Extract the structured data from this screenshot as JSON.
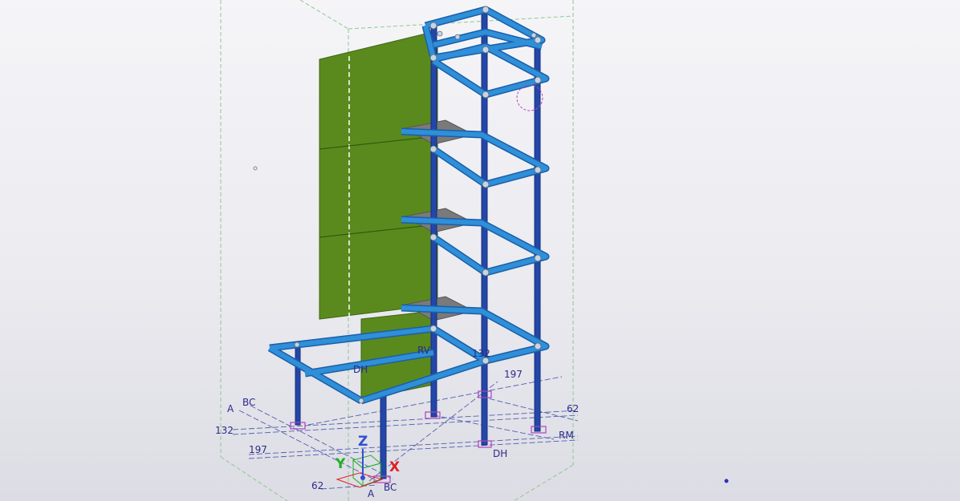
{
  "viewport": {
    "background_top": "#f5f5f8",
    "background_bottom": "#dcdce4"
  },
  "colors": {
    "beam": "#2f8fd8",
    "beam_edge": "#1a5fa8",
    "column": "#2347a8",
    "column_edge": "#162f78",
    "panel": "#5a8a1e",
    "panel_edge": "#3e6612",
    "plate": "#7a7a7a",
    "bounding_box": "#8fc88f",
    "grid_line": "#5060b0",
    "anchor": "#b040c0",
    "axis_x": "#e02020",
    "axis_y": "#20b020",
    "axis_z": "#3050d0"
  },
  "grid_labels": {
    "left_a": "A",
    "left_bc": "BC",
    "left_132": "132",
    "left_197": "197",
    "bottom_62": "62",
    "bottom_a": "A",
    "bottom_bc": "BC",
    "mid_dh": "DH",
    "mid_rv": "RV",
    "mid_132": "132",
    "mid_197": "197",
    "right_62": "62",
    "right_rm": "RM",
    "bottom_dh": "DH"
  },
  "axes": {
    "x": "X",
    "y": "Y",
    "z": "Z"
  }
}
